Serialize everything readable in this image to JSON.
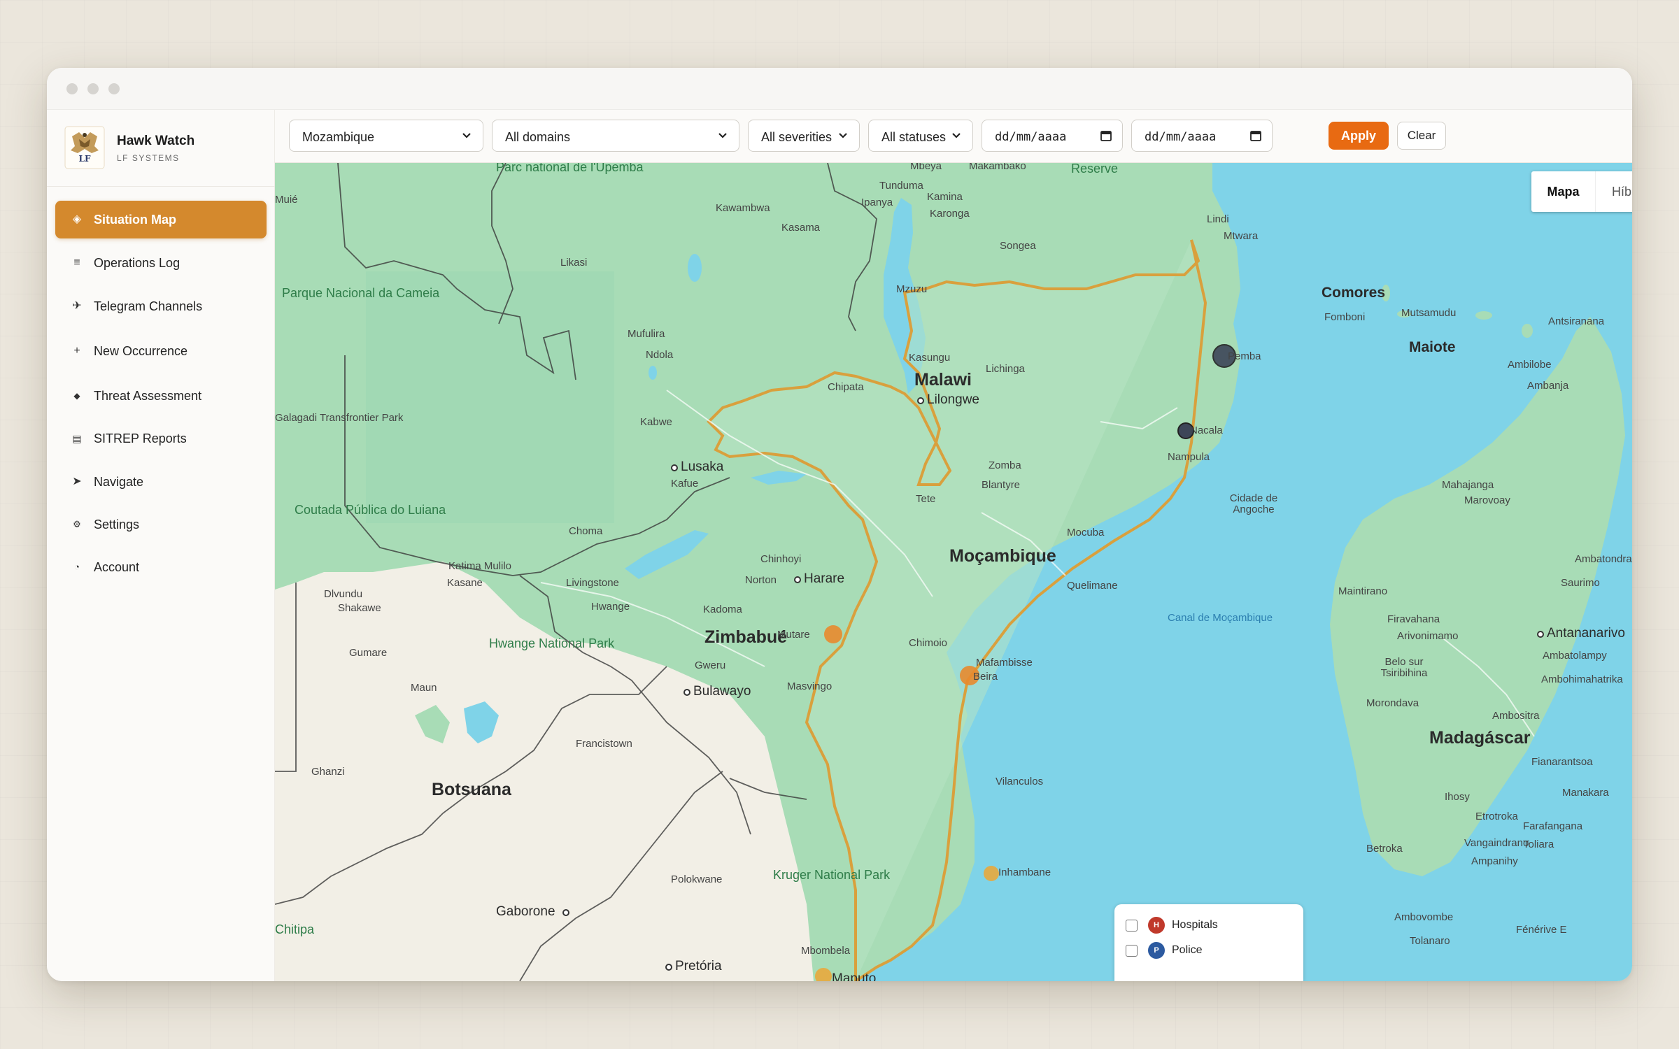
{
  "app": {
    "name": "Hawk Watch",
    "subtitle": "LF SYSTEMS",
    "logo_initials": "LF"
  },
  "sidebar": {
    "items": [
      {
        "label": "Situation Map",
        "icon": "diamond-icon",
        "active": true
      },
      {
        "label": "Operations Log",
        "icon": "list-icon"
      },
      {
        "label": "Telegram Channels",
        "icon": "plane-icon"
      },
      {
        "label": "New Occurrence",
        "icon": "plus-icon"
      },
      {
        "label": "Threat Assessment",
        "icon": "small-diamond-icon"
      },
      {
        "label": "SITREP Reports",
        "icon": "document-icon"
      },
      {
        "label": "Navigate",
        "icon": "arrow-icon"
      },
      {
        "label": "Settings",
        "icon": "gear-icon"
      },
      {
        "label": "Account",
        "icon": "user-icon"
      }
    ]
  },
  "filters": {
    "country": "Mozambique",
    "domain": "All domains",
    "severity": "All severities",
    "status": "All statuses",
    "date_from": "dd/mm/aaaa",
    "date_to": "dd/mm/aaaa",
    "apply_label": "Apply",
    "clear_label": "Clear"
  },
  "map_type": {
    "options": [
      "Mapa",
      "Híbrido"
    ],
    "selected": "Mapa"
  },
  "legend": {
    "items": [
      {
        "badge": "H",
        "label": "Hospitals",
        "color": "#c0392b",
        "checked": false
      },
      {
        "badge": "P",
        "label": "Police",
        "color": "#2c5aa0",
        "checked": false
      }
    ]
  },
  "colors": {
    "accent": "#d4892d",
    "apply": "#e86a12",
    "land": "#a8dcb6",
    "water": "#7fd3e8",
    "border": "#d9a03d",
    "dry_land": "#f2efe6"
  },
  "map_labels": {
    "countries": [
      "Malawi",
      "Moçambique",
      "Zimbabué",
      "Botsuana",
      "Madagáscar",
      "Comores",
      "Maiote"
    ],
    "regions": [
      "Parque Nacional da Cameia",
      "Parc national de l'Upemba",
      "Hwange National Park",
      "Kruger National Park",
      "Coutada Pública do Luiana",
      "Reserve",
      "Canal de Moçambique"
    ],
    "cities": [
      "Lilongwe",
      "Lusaka",
      "Harare",
      "Bulawayo",
      "Pretória",
      "Gaborone",
      "Antananarivo",
      "Maputo",
      "Beira",
      "Nampula",
      "Pemba",
      "Nacala",
      "Tete",
      "Quelimane",
      "Chimoio",
      "Inhambane",
      "Vilanculos",
      "Mutare",
      "Mocuba",
      "Lichinga",
      "Blantyre",
      "Zomba",
      "Mzuzu",
      "Karonga",
      "Chipata",
      "Kasungu",
      "Mbeya",
      "Makambako",
      "Songea",
      "Lindi",
      "Mtwara",
      "Tunduma",
      "Kawambwa",
      "Kasama",
      "Likasi",
      "Mufulira",
      "Ndola",
      "Kabwe",
      "Kafue",
      "Choma",
      "Livingstone",
      "Kasane",
      "Katima Mulilo",
      "Dlvundu",
      "Shakawe",
      "Gumare",
      "Maun",
      "Francistown",
      "Ghanzi",
      "Hwange",
      "Kadoma",
      "Gweru",
      "Masvingo",
      "Chinhoyi",
      "Norton",
      "Polokwane",
      "Mbombela",
      "Cidade de Angoche",
      "Mafambisse",
      "Fomboni",
      "Mutsamudu",
      "Antsiranana",
      "Ambilobe",
      "Ambanja",
      "Mahajanga",
      "Marovoay",
      "Maintirano",
      "Firavahana",
      "Arivonimamo",
      "Ambatolampy",
      "Belo sur Tsiribihina",
      "Ambohimahatrika",
      "Morondava",
      "Ambositra",
      "Fianarantsoa",
      "Ihosy",
      "Manakara",
      "Etrotroka",
      "Farafangana",
      "Toliara",
      "Betroka",
      "Vangaindrano",
      "Ampanihy",
      "Ambovombe",
      "Tolanaro",
      "Fénérive E",
      "Ambatondrazaka",
      "Saurimo",
      "Muié",
      "Galagadi Transfrontier Park",
      "Chitipa",
      "Ipanya",
      "Kamina"
    ]
  }
}
